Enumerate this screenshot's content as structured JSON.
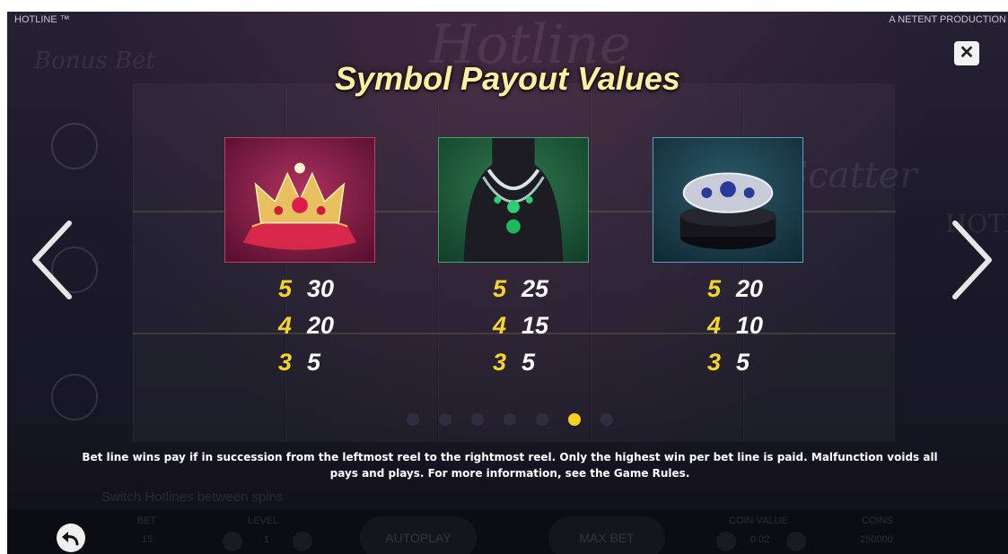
{
  "header": {
    "game_name": "HOTLINE ™",
    "producer": "A NETENT PRODUCTION"
  },
  "title": "Symbol Payout Values",
  "background": {
    "bonus_bet_text": "Bonus Bet",
    "logo_text": "Hotline",
    "scatter_text": "Scatter",
    "hotel_text": "HOTE"
  },
  "symbols": [
    {
      "icon": "crown-on-cushion-icon",
      "border_color": "#c0405a",
      "payouts": [
        {
          "count": "5",
          "value": "30"
        },
        {
          "count": "4",
          "value": "20"
        },
        {
          "count": "3",
          "value": "5"
        }
      ]
    },
    {
      "icon": "emerald-necklace-icon",
      "border_color": "#4aa070",
      "payouts": [
        {
          "count": "5",
          "value": "25"
        },
        {
          "count": "4",
          "value": "15"
        },
        {
          "count": "3",
          "value": "5"
        }
      ]
    },
    {
      "icon": "diamond-ring-icon",
      "border_color": "#5aa0c8",
      "payouts": [
        {
          "count": "5",
          "value": "20"
        },
        {
          "count": "4",
          "value": "10"
        },
        {
          "count": "3",
          "value": "5"
        }
      ]
    }
  ],
  "pager": {
    "total": 7,
    "active_index": 5
  },
  "rules_text": "Bet line wins pay if in succession from the leftmost reel to the rightmost reel. Only the highest win per bet line is paid. Malfunction voids all pays and plays. For more information, see the Game Rules.",
  "hud": {
    "switch_hint": "Switch Hotlines between spins",
    "bet_label": "BET",
    "bet_value": "15",
    "level_label": "LEVEL",
    "level_value": "1",
    "autoplay_label": "AUTOPLAY",
    "max_bet_label": "MAX BET",
    "coin_value_label": "COIN VALUE",
    "coin_value": "0.02",
    "coins_label": "COINS",
    "coins_value": "250000"
  },
  "colors": {
    "title": "#fdf0a0",
    "payout_count": "#f6d52a",
    "payout_value": "#ffffff",
    "active_dot": "#f5d01f"
  }
}
